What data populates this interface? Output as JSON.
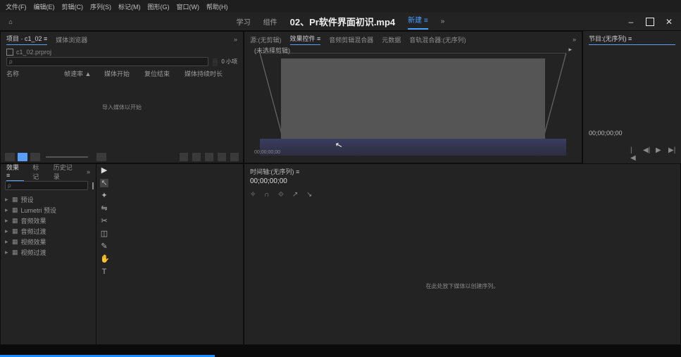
{
  "menu": {
    "items": [
      "文件(F)",
      "编辑(E)",
      "剪辑(C)",
      "序列(S)",
      "标记(M)",
      "图形(G)",
      "窗口(W)",
      "帮助(H)"
    ]
  },
  "workspace": {
    "home": "⌂",
    "tab_learn": "学习",
    "tab_component": "组件",
    "title": "02、Pr软件界面初识.mp4",
    "tab_new": "新建 ≡",
    "chevron": "»",
    "min": "–",
    "close": "✕"
  },
  "project": {
    "tab1": "项目 · c1_02 ≡",
    "tab2": "媒体浏览器",
    "chevron": "»",
    "file": "c1_02.prproj",
    "search_ph": "ρ",
    "bin": "░",
    "count": "0 小项",
    "col1": "名称",
    "col2": "帧速率 ▲",
    "col3": "媒体开始",
    "col4": "复位结束",
    "col5": "媒体持续时长",
    "hint": "导入媒体以开始"
  },
  "source": {
    "tab1": "源:(无剪辑)",
    "tab2": "效果控件 ≡",
    "tab3": "音频剪辑混合器",
    "tab4": "元数据",
    "tab5": "音轨混合器:(无序列)",
    "chevron": "»",
    "sel": "(未选择剪辑)",
    "arrow": "▸",
    "tc": "00;00;00;00"
  },
  "program": {
    "tab": "节目:(无序列) ≡",
    "tc": "00;00;00;00",
    "c1": "|◀",
    "c2": "◀|",
    "c3": "▶",
    "c4": "▶|"
  },
  "effects": {
    "tab1": "效果 ≡",
    "tab2": "标记",
    "tab3": "历史记录",
    "chevron": "»",
    "search_ph": "ρ",
    "i1": "预设",
    "i2": "Lumetri 预设",
    "i3": "音频效果",
    "i4": "音频过渡",
    "i5": "视频效果",
    "i6": "视频过渡"
  },
  "tools": {
    "t0": "▶",
    "t1": "↖",
    "t2": "✦",
    "t3": "⇋",
    "t4": "✂",
    "t5": "◫",
    "t6": "✎",
    "t7": "✋",
    "t8": "T"
  },
  "timeline": {
    "tab": "时间轴:(无序列) ≡",
    "tc": "00;00;00;00",
    "c1": "✧",
    "c2": "∩",
    "c3": "⟐",
    "c4": "↗",
    "c5": "↘",
    "hint": "在此处放下媒体以创建序列。"
  }
}
